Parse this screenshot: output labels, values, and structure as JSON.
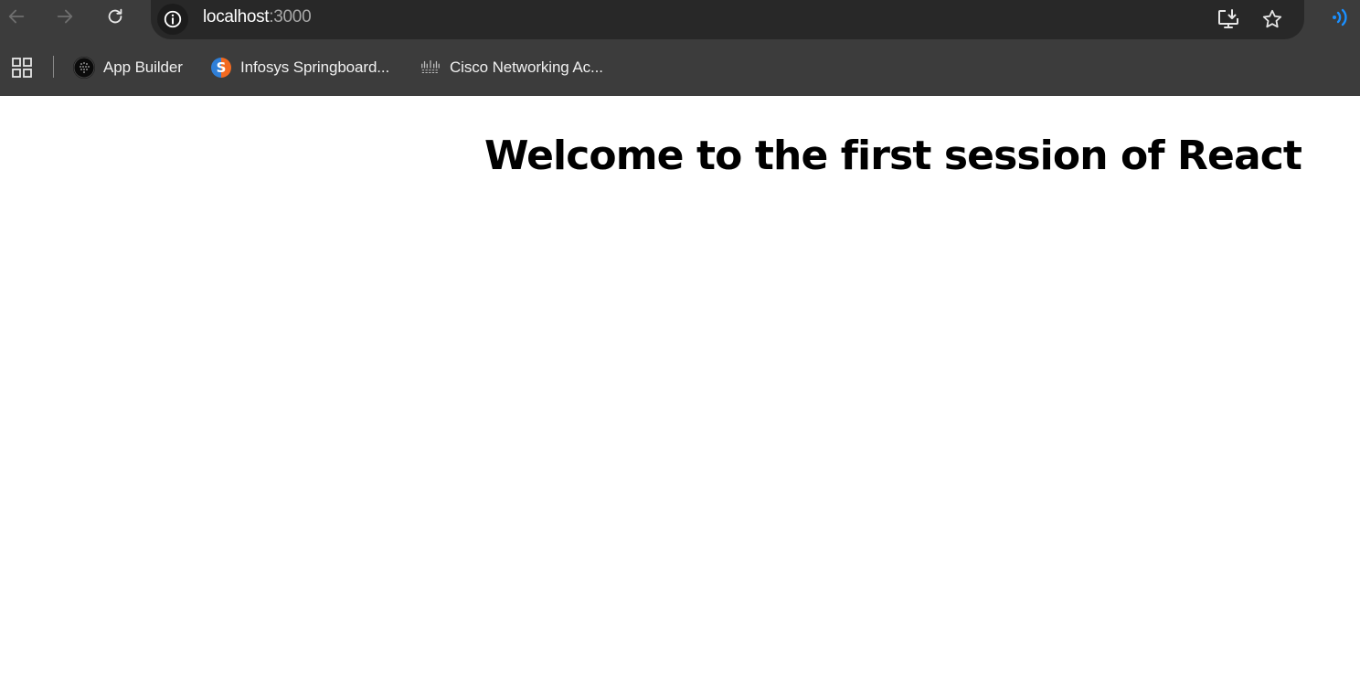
{
  "browser": {
    "url_host": "localhost",
    "url_port": ":3000",
    "icons": {
      "back": "arrow-left-icon",
      "forward": "arrow-right-icon",
      "reload": "reload-icon",
      "site_info": "info-icon",
      "install": "install-app-icon",
      "bookmark_star": "star-icon",
      "extension": "broadcast-icon"
    },
    "colors": {
      "toolbar_bg": "#3c3c3c",
      "omnibox_bg": "#282828",
      "extension_accent": "#1a8fff"
    }
  },
  "bookmarks": {
    "items": [
      {
        "label": "App Builder",
        "icon": "app-builder-icon"
      },
      {
        "label": "Infosys Springboard...",
        "icon": "springboard-s-icon"
      },
      {
        "label": "Cisco Networking Ac...",
        "icon": "cisco-logo-icon"
      }
    ]
  },
  "page": {
    "heading": "Welcome to the first session of React"
  }
}
